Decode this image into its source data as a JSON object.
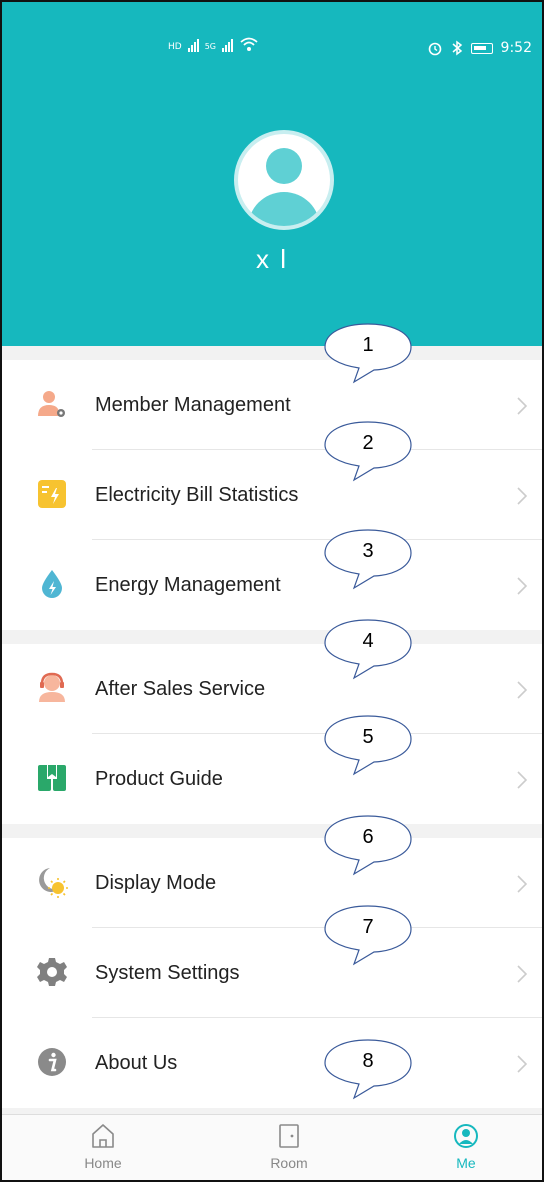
{
  "status_bar": {
    "time": "9:52",
    "net_left": "HD",
    "net_5g": "5G"
  },
  "profile": {
    "username": "x l"
  },
  "menu_groups": [
    {
      "items": [
        {
          "label": "Member Management",
          "icon": "member-icon"
        },
        {
          "label": "Electricity Bill Statistics",
          "icon": "electricity-icon"
        },
        {
          "label": "Energy Management",
          "icon": "energy-icon"
        }
      ]
    },
    {
      "items": [
        {
          "label": "After Sales Service",
          "icon": "support-icon"
        },
        {
          "label": "Product Guide",
          "icon": "guide-icon"
        }
      ]
    },
    {
      "items": [
        {
          "label": "Display Mode",
          "icon": "display-mode-icon"
        },
        {
          "label": "System Settings",
          "icon": "settings-icon"
        },
        {
          "label": "About Us",
          "icon": "info-icon"
        }
      ]
    }
  ],
  "callouts": [
    "1",
    "2",
    "3",
    "4",
    "5",
    "6",
    "7",
    "8"
  ],
  "tabbar": {
    "tabs": [
      {
        "label": "Home",
        "icon": "home-icon"
      },
      {
        "label": "Room",
        "icon": "door-icon"
      },
      {
        "label": "Me",
        "icon": "profile-icon",
        "active": true
      }
    ]
  },
  "colors": {
    "accent": "#16b8be",
    "background": "#f2f2f2"
  }
}
